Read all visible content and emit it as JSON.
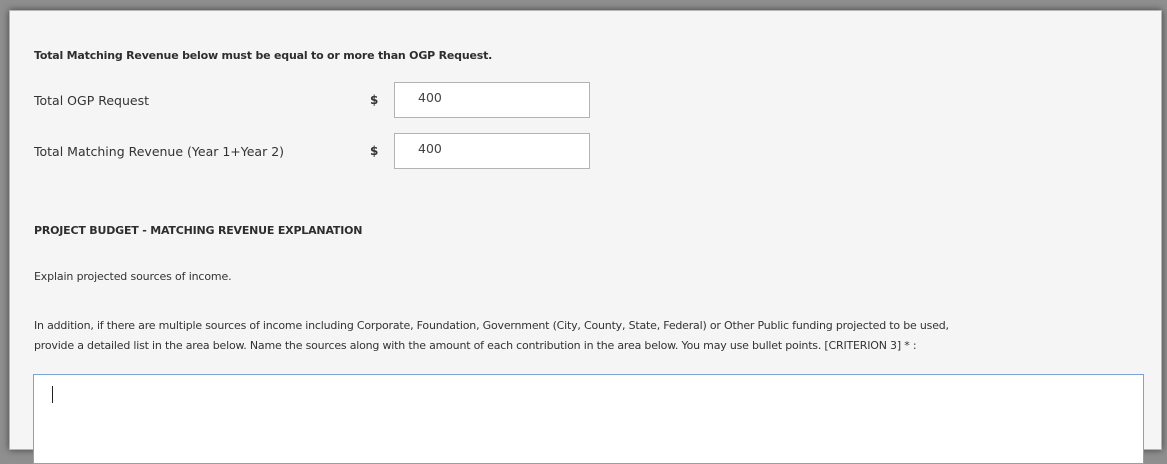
{
  "form": {
    "note": "Total Matching Revenue below must be equal to or more than OGP Request.",
    "ogp_request": {
      "label": "Total OGP Request",
      "currency": "$",
      "value": "400"
    },
    "matching_revenue": {
      "label": "Total Matching Revenue (Year 1+Year 2)",
      "currency": "$",
      "value": "400"
    },
    "section_heading": "PROJECT BUDGET - MATCHING REVENUE EXPLANATION",
    "explain_text": "Explain projected sources of income.",
    "instructions_line1": "In addition, if there are multiple sources of income including Corporate, Foundation, Government (City, County, State, Federal) or Other Public funding projected to be used,",
    "instructions_line2": "provide a detailed list in the area below. Name the sources along with the amount of each contribution in the area below.  You may use bullet points. [CRITERION 3] * :",
    "explanation_value": ""
  }
}
